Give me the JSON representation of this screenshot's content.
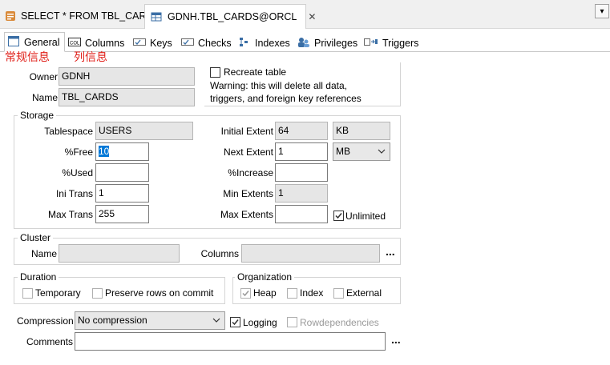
{
  "doc_tabs": [
    {
      "label": "SELECT * FROM TBL_CARDS",
      "icon": "sql-query-icon"
    },
    {
      "label": "GDNH.TBL_CARDS@ORCL",
      "icon": "table-icon",
      "close": "✕"
    }
  ],
  "dropdown_glyph": "▾",
  "inner_tabs": [
    {
      "label": "General",
      "icon": "general-icon"
    },
    {
      "label": "Columns",
      "icon": "columns-icon"
    },
    {
      "label": "Keys",
      "icon": "keys-icon"
    },
    {
      "label": "Checks",
      "icon": "checks-icon"
    },
    {
      "label": "Indexes",
      "icon": "indexes-icon"
    },
    {
      "label": "Privileges",
      "icon": "privileges-icon"
    },
    {
      "label": "Triggers",
      "icon": "triggers-icon"
    }
  ],
  "annotations": {
    "general": "常规信息",
    "columns": "列信息"
  },
  "general": {
    "owner_label": "Owner",
    "owner_value": "GDNH",
    "name_label": "Name",
    "name_value": "TBL_CARDS",
    "recreate_label": "Recreate table",
    "warning_line1": "Warning: this will delete all data,",
    "warning_line2": "triggers, and foreign key references"
  },
  "storage": {
    "title": "Storage",
    "tablespace_label": "Tablespace",
    "tablespace_value": "USERS",
    "pctfree_label": "%Free",
    "pctfree_value": "10",
    "pctused_label": "%Used",
    "pctused_value": "",
    "initrans_label": "Ini Trans",
    "initrans_value": "1",
    "maxtrans_label": "Max Trans",
    "maxtrans_value": "255",
    "initial_extent_label": "Initial Extent",
    "initial_extent_value": "64",
    "initial_extent_unit": "KB",
    "next_extent_label": "Next Extent",
    "next_extent_value": "1",
    "next_extent_unit": "MB",
    "pctincrease_label": "%Increase",
    "pctincrease_value": "",
    "min_extents_label": "Min Extents",
    "min_extents_value": "1",
    "max_extents_label": "Max Extents",
    "max_extents_value": "",
    "unlimited_label": "Unlimited"
  },
  "cluster": {
    "title": "Cluster",
    "name_label": "Name",
    "name_value": "",
    "columns_label": "Columns",
    "columns_value": "",
    "browse": "..."
  },
  "duration": {
    "title": "Duration",
    "temporary_label": "Temporary",
    "preserve_label": "Preserve rows on commit"
  },
  "organization": {
    "title": "Organization",
    "heap_label": "Heap",
    "index_label": "Index",
    "external_label": "External"
  },
  "compression_label": "Compression",
  "compression_value": "No compression",
  "logging_label": "Logging",
  "rowdependencies_label": "Rowdependencies",
  "comments_label": "Comments",
  "comments_value": "",
  "comments_browse": "...",
  "colors": {
    "annotation_red": "#e0201a",
    "selection_blue": "#0078d7",
    "checkmark": "#333333"
  }
}
